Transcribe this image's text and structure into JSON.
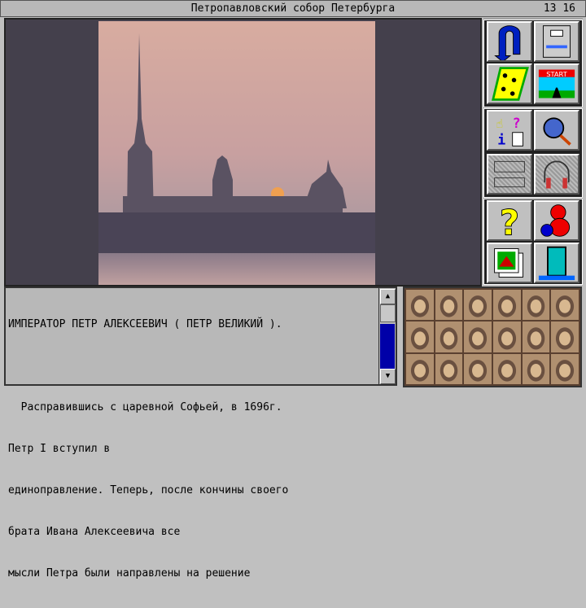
{
  "titlebar": {
    "title": "Петропавловский собор Петербурга",
    "clock": "13 16"
  },
  "text": {
    "lines": [
      "ИМПЕРАТОР ПЕТР АЛЕКСЕЕВИЧ ( ПЕТР ВЕЛИКИЙ ).",
      "",
      "  Расправившись с царевной Софьей, в 1696г.",
      "Петр I вступил в",
      "единоправление. Теперь, после кончины своего",
      "брата Ивана Алексеевича все",
      "мысли Петра были направлены на решение"
    ]
  },
  "buttons": [
    "back-icon",
    "save-disk-icon",
    "footprints-icon",
    "start-icon",
    "info-help-icon",
    "magnifier-icon",
    "video-player-icon",
    "headphones-icon",
    "question-icon",
    "teddy-bear-icon",
    "slides-icon",
    "exit-door-icon"
  ],
  "portraits_count": 18
}
